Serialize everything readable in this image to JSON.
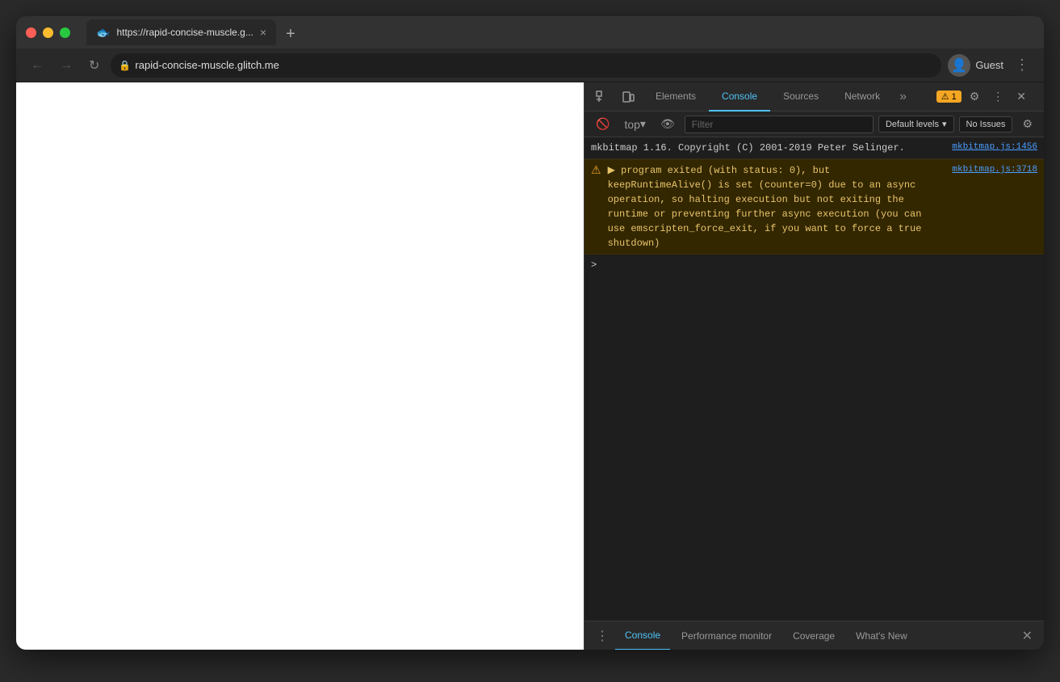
{
  "browser": {
    "title": "https://rapid-concise-muscle.g...",
    "url": "rapid-concise-muscle.glitch.me",
    "favicon": "🐟",
    "tab_close": "×",
    "new_tab": "+",
    "chevron": "❯"
  },
  "nav": {
    "back": "←",
    "forward": "→",
    "refresh": "↻",
    "lock_icon": "🔒",
    "profile_label": "Guest",
    "more": "⋮"
  },
  "devtools": {
    "tabs": [
      {
        "label": "Elements",
        "active": false
      },
      {
        "label": "Console",
        "active": true
      },
      {
        "label": "Sources",
        "active": false
      },
      {
        "label": "Network",
        "active": false
      }
    ],
    "warning_count": "1",
    "toolbar_icons": [
      "cursor",
      "box",
      "mobile",
      "ban",
      "eye",
      "settings",
      "dots",
      "close"
    ],
    "console_top": "top",
    "filter_placeholder": "Filter",
    "default_levels": "Default levels",
    "no_issues": "No Issues"
  },
  "console": {
    "lines": [
      {
        "type": "info",
        "text": "mkbitmap 1.16. Copyright (C) 2001-2019 Peter Selinger.",
        "source": "mkbitmap.js:1456"
      },
      {
        "type": "warning",
        "text": "▶ program exited (with status: 0), but keepRuntimeAlive() is set (counter=0) due to an async operation, so halting execution but not exiting the runtime or preventing further async execution (you can use emscripten_force_exit, if you want to force a true shutdown)",
        "source": "mkbitmap.js:3718"
      }
    ],
    "prompt": ">"
  },
  "bottom_tabs": [
    {
      "label": "Console",
      "active": true
    },
    {
      "label": "Performance monitor",
      "active": false
    },
    {
      "label": "Coverage",
      "active": false
    },
    {
      "label": "What's New",
      "active": false
    }
  ]
}
